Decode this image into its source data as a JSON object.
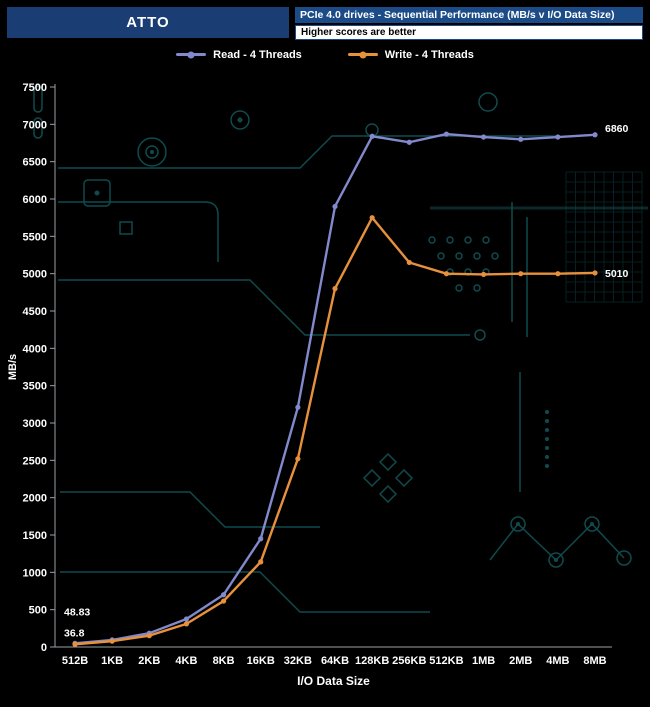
{
  "header": {
    "app_title": "ATTO",
    "chart_title": "PCIe 4.0 drives - Sequential Performance (MB/s v I/O Data Size)",
    "subtitle": "Higher scores are better"
  },
  "legend": [
    {
      "label": "Read - 4 Threads",
      "color": "#8289cc"
    },
    {
      "label": "Write - 4 Threads",
      "color": "#e8913c"
    }
  ],
  "chart_data": {
    "type": "line",
    "categories": [
      "512B",
      "1KB",
      "2KB",
      "4KB",
      "8KB",
      "16KB",
      "32KB",
      "64KB",
      "128KB",
      "256KB",
      "512KB",
      "1MB",
      "2MB",
      "4MB",
      "8MB"
    ],
    "series": [
      {
        "name": "Read - 4 Threads",
        "color": "#8289cc",
        "values": [
          48.83,
          95,
          185,
          375,
          700,
          1450,
          3210,
          5900,
          6840,
          6760,
          6870,
          6830,
          6800,
          6830,
          6860
        ]
      },
      {
        "name": "Write - 4 Threads",
        "color": "#e8913c",
        "values": [
          36.8,
          78,
          152,
          310,
          615,
          1140,
          2520,
          4800,
          5750,
          5150,
          5000,
          4990,
          5000,
          5000,
          5010
        ]
      }
    ],
    "title": "PCIe 4.0 drives - Sequential Performance (MB/s v I/O Data Size)",
    "xlabel": "I/O Data Size",
    "ylabel": "MB/s",
    "ylim": [
      0,
      7500
    ],
    "ytick_step": 500,
    "grid": false,
    "legend_position": "top",
    "annotations": [
      {
        "text": "48.83",
        "series_index": 0,
        "x_index": 0,
        "dx": -11,
        "dy": -28,
        "color": "#9aa0e0"
      },
      {
        "text": "36.8",
        "series_index": 1,
        "x_index": 0,
        "dx": -11,
        "dy": -8,
        "color": "#e8913c"
      },
      {
        "text": "6860",
        "series_index": 0,
        "x_index": 14,
        "dx": 10,
        "dy": -3,
        "color": "#ffffff"
      },
      {
        "text": "5010",
        "series_index": 1,
        "x_index": 14,
        "dx": 10,
        "dy": 4,
        "color": "#ffffff"
      }
    ]
  }
}
